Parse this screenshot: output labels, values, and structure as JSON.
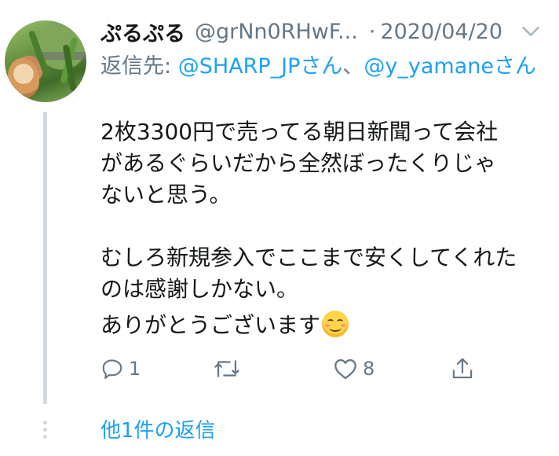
{
  "tweet": {
    "display_name": "ぷるぷる",
    "handle": "@grNn0RHwF...",
    "separator": "·",
    "date": "2020/04/20",
    "reply_to": {
      "prefix": "返信先: ",
      "mention_1": "@SHARP_JPさん",
      "joiner": "、",
      "mention_2": "@y_yamaneさん"
    },
    "text_lines": [
      "2枚3300円で売ってる朝日新聞って会社",
      "があるぐらいだから全然ぼったくりじゃ",
      "ないと思う。",
      "",
      "むしろ新規参入でここまで安くしてくれた",
      "のは感謝しかない。",
      "ありがとうございます"
    ],
    "emoji": "smiling-face-emoji",
    "actions": {
      "reply_count": "1",
      "retweet_count": "",
      "like_count": "8"
    },
    "more_replies": "他1件の返信"
  },
  "colors": {
    "text": "#14171a",
    "secondary": "#657786",
    "link": "#1da1f2",
    "thread_line": "#cfd9de"
  },
  "icons": {
    "menu": "chevron-down-icon",
    "reply": "reply-icon",
    "retweet": "retweet-icon",
    "like": "heart-icon",
    "share": "share-icon"
  }
}
